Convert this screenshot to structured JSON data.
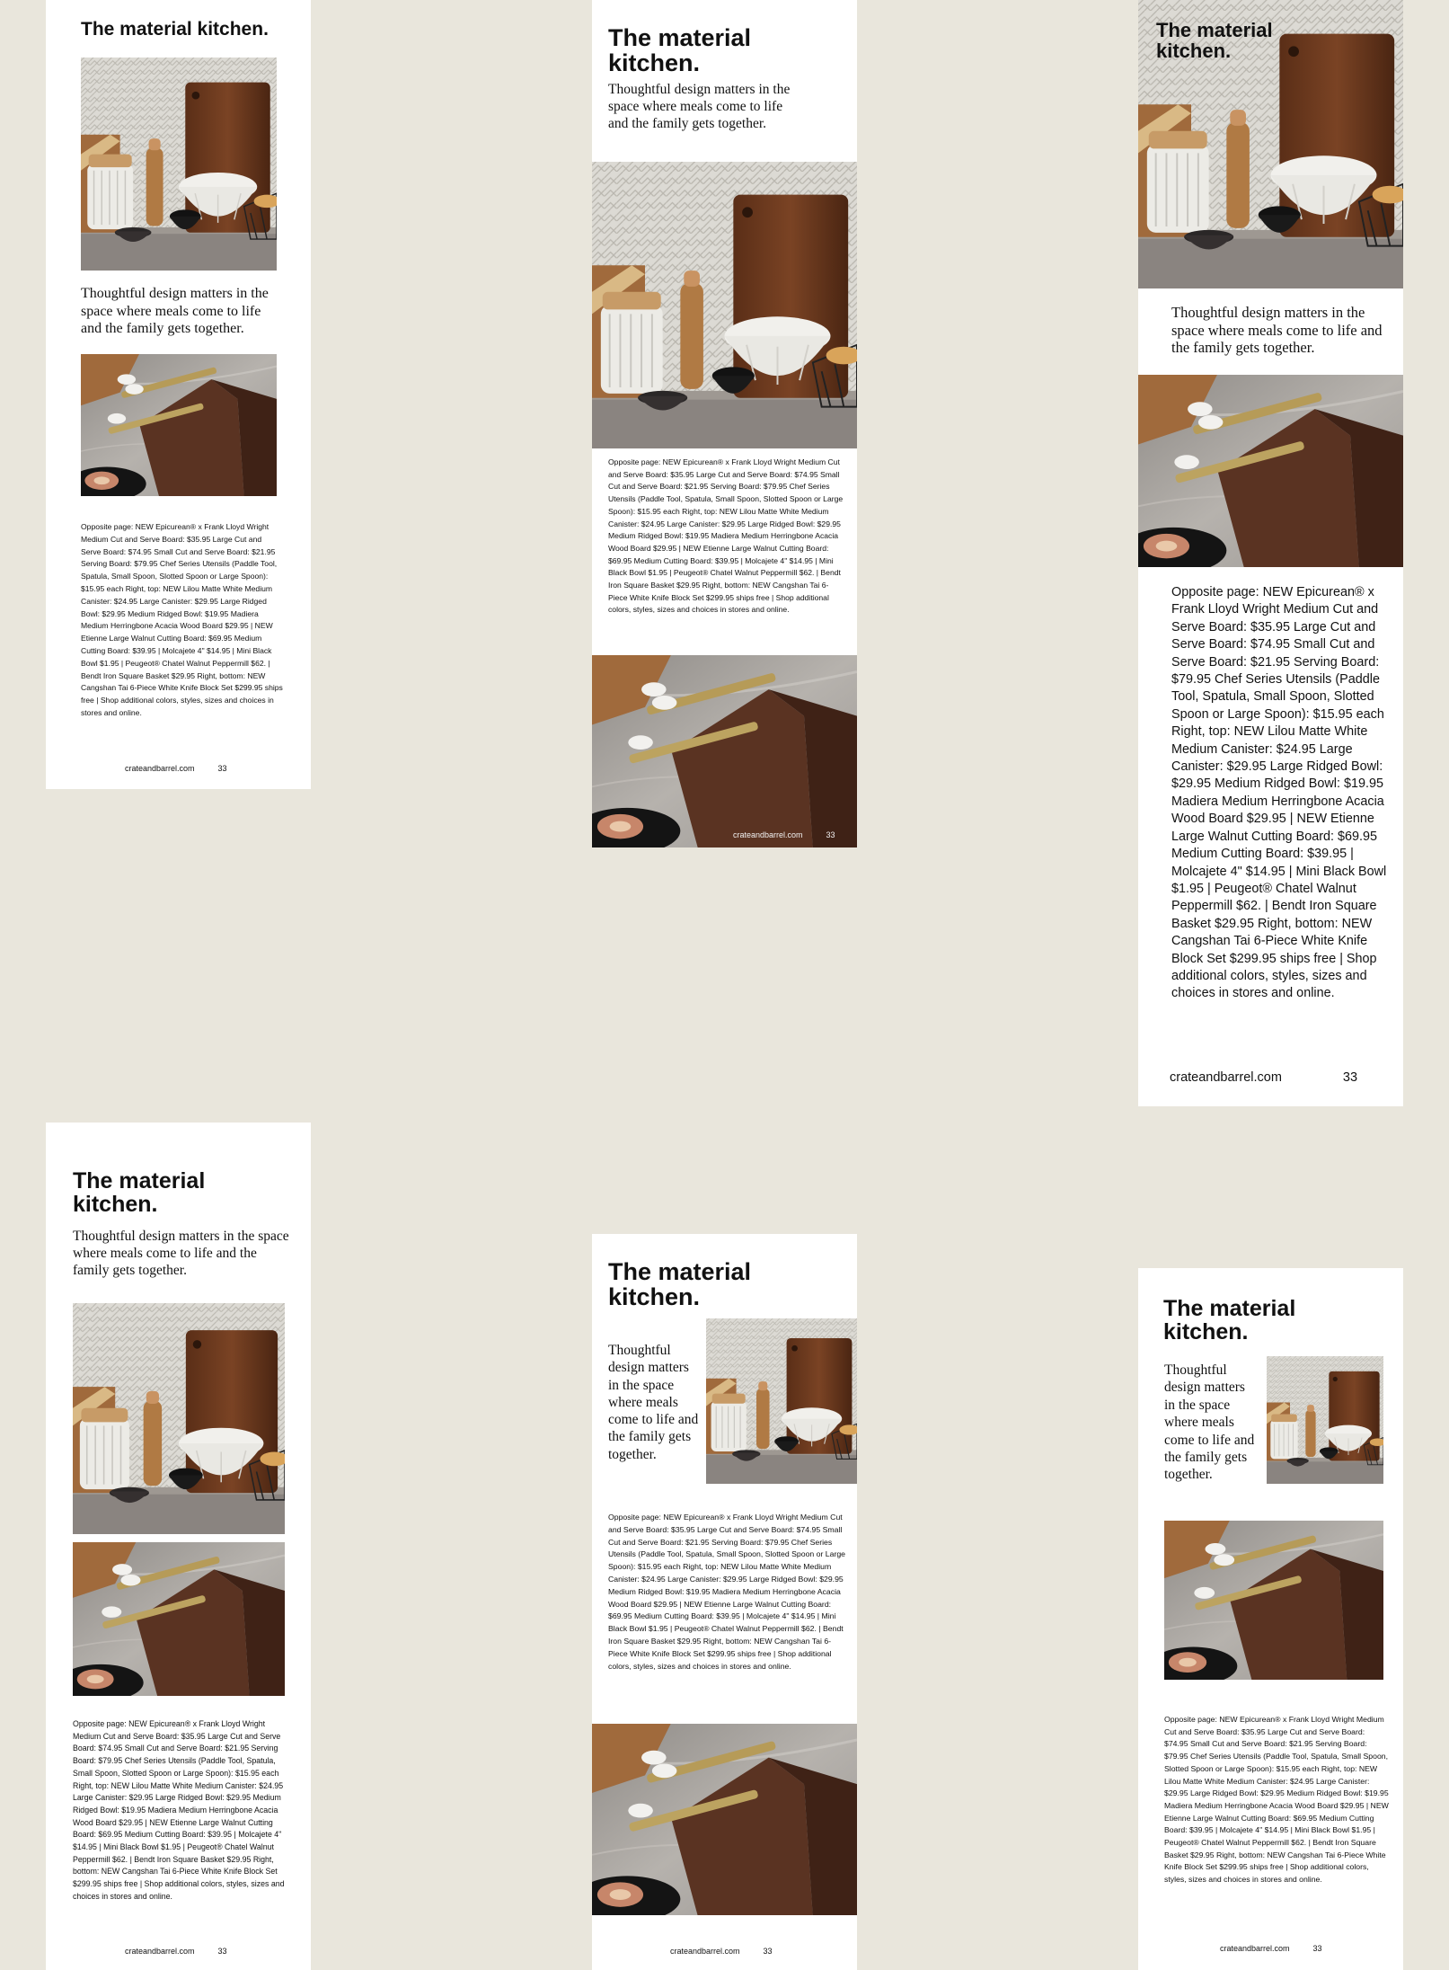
{
  "title": "The material kitchen.",
  "intro": "Thoughtful design matters in the space where meals come to life and the family gets together.",
  "caption": "Opposite page: NEW Epicurean® x Frank Lloyd Wright Medium Cut and Serve Board: $35.95 Large Cut and Serve Board: $74.95 Small Cut and Serve Board: $21.95 Serving Board: $79.95 Chef Series Utensils (Paddle Tool, Spatula, Small Spoon, Slotted Spoon or Large Spoon): $15.95 each Right, top: NEW Lilou Matte White Medium Canister: $24.95 Large Canister: $29.95 Large Ridged Bowl: $29.95 Medium Ridged Bowl: $19.95 Madiera Medium Herringbone Acacia Wood Board $29.95 | NEW Etienne Large Walnut Cutting Board: $69.95 Medium Cutting Board: $39.95 | Molcajete 4\" $14.95 |  Mini Black Bowl $1.95 |  Peugeot® Chatel Walnut Peppermill $62. |  Bendt Iron Square Basket $29.95 Right, bottom: NEW Cangshan Tai 6-Piece White Knife Block Set $299.95 ships free | Shop additional colors, styles, sizes and choices in stores and online.",
  "footer": {
    "site": "crateandbarrel.com",
    "page_number": "33"
  },
  "images": {
    "kitchen": "kitchen-still-life-photo",
    "knife_block": "knife-block-photo"
  }
}
